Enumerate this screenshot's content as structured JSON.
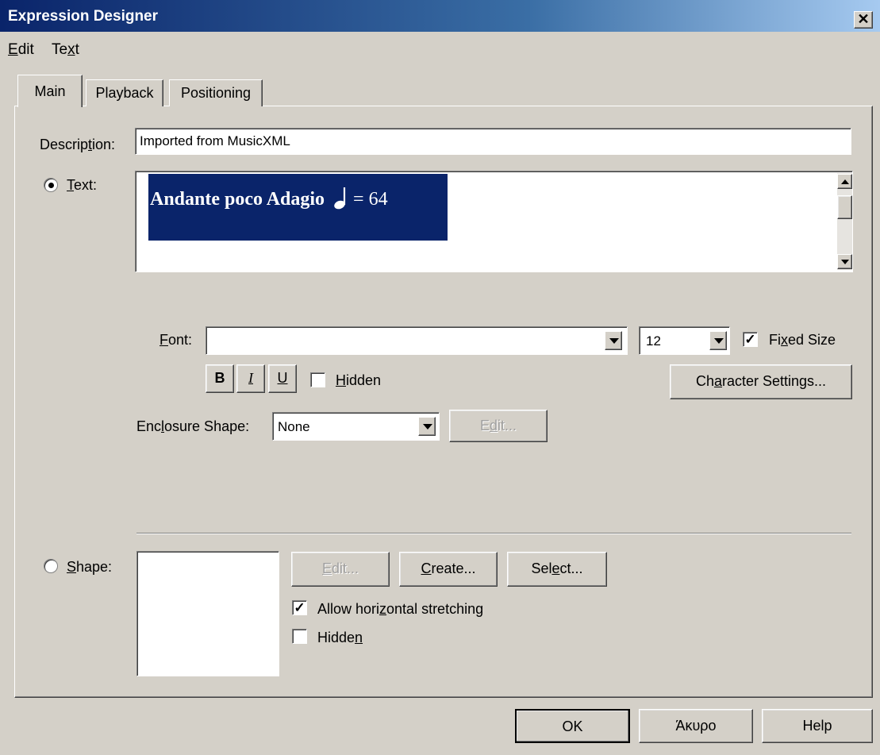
{
  "window": {
    "title": "Expression Designer",
    "close_glyph": "✕"
  },
  "menu": [
    {
      "label": "Edit"
    },
    {
      "label": "Text"
    }
  ],
  "tabs": [
    {
      "label": "Main",
      "active": true
    },
    {
      "label": "Playback",
      "active": false
    },
    {
      "label": "Positioning",
      "active": false
    }
  ],
  "main": {
    "description_label": "Description:",
    "description_value": "Imported from MusicXML",
    "text_radio_label": "Text:",
    "text_radio_selected": true,
    "text_content": {
      "title": "Andante poco Adagio",
      "tempo_equals": "= 64",
      "note_icon": "half-note-icon"
    },
    "font_label": "Font:",
    "font_value": "",
    "size_value": "12",
    "fixed_size_label": "Fixed Size",
    "fixed_size_checked": true,
    "bold_label": "B",
    "italic_label": "I",
    "underline_label": "U",
    "hidden_label": "Hidden",
    "hidden_checked": false,
    "character_settings_label": "Character Settings...",
    "enclosure_label": "Enclosure Shape:",
    "enclosure_value": "None",
    "enclosure_edit_label": "Edit...",
    "shape_radio_label": "Shape:",
    "shape_radio_selected": false,
    "shape_edit_label": "Edit...",
    "shape_create_label": "Create...",
    "shape_select_label": "Select...",
    "allow_stretch_label": "Allow horizontal stretching",
    "allow_stretch_checked": true,
    "shape_hidden_label": "Hidden",
    "shape_hidden_checked": false
  },
  "footer": {
    "ok_label": "OK",
    "cancel_label": "Άκυρο",
    "help_label": "Help"
  },
  "colors": {
    "dialog_bg": "#d4d0c8",
    "title_gradient_start": "#0a246a",
    "selection_bg": "#0a246a"
  }
}
